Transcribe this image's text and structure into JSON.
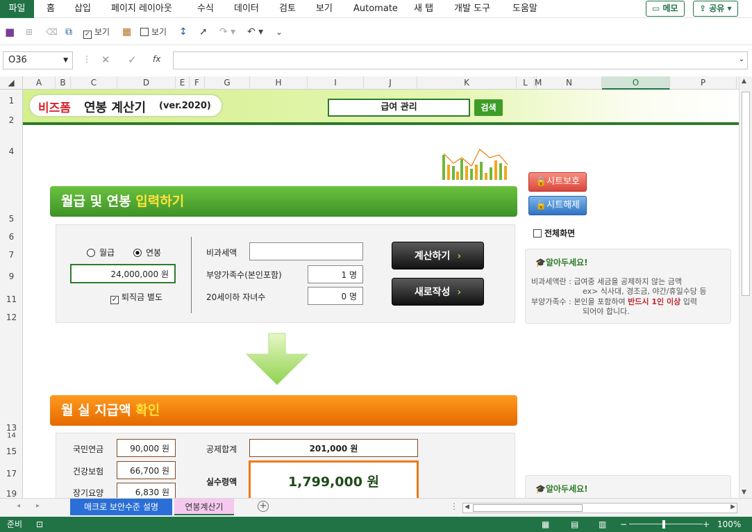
{
  "ribbon": {
    "tabs": [
      "파일",
      "홈",
      "삽입",
      "페이지 레이아웃",
      "수식",
      "데이터",
      "검토",
      "보기",
      "Automate",
      "새 탭",
      "개발 도구",
      "도움말"
    ],
    "memo_label": "메모",
    "share_label": "공유"
  },
  "qat": {
    "view1": "보기",
    "view2": "보기"
  },
  "formula": {
    "name_box": "O36",
    "fx": "fx",
    "content": ""
  },
  "columns": [
    "A",
    "B",
    "C",
    "D",
    "E",
    "F",
    "G",
    "H",
    "I",
    "J",
    "K",
    "L",
    "M",
    "N",
    "O",
    "P"
  ],
  "rows": [
    "1",
    "2",
    "4",
    "5",
    "6",
    "7",
    "9",
    "11",
    "12",
    "13",
    "14",
    "15",
    "17",
    "19"
  ],
  "banner": {
    "brand": "비즈폼",
    "title": "연봉 계산기",
    "version": "(ver.2020)",
    "search_box": "급여 관리",
    "search_button": "검색"
  },
  "side": {
    "protect": "시트보호",
    "unprotect": "시트해제",
    "fullscreen": "전체화면"
  },
  "section1": {
    "title_a": "월급 및 연봉 ",
    "title_b": "입력하기"
  },
  "input": {
    "radio_monthly": "월급",
    "radio_annual": "연봉",
    "amount": "24,000,000 원",
    "severance": "퇴직금 별도",
    "nontax_label": "비과세액",
    "nontax_value": "",
    "dependents_label": "부양가족수(본인포함)",
    "dependents_value": "1 명",
    "children_label": "20세이하 자녀수",
    "children_value": "0 명",
    "calc_button": "계산하기",
    "new_button": "새로작성"
  },
  "notice1": {
    "title": "알아두세요!",
    "l1a": "비과세액란 :",
    "l1b": "급여중 세금을 공제하지 않는 금액",
    "l2": "ex> 식사대, 경조금, 야간/휴일수당 등",
    "l3a": "부양가족수 :",
    "l3b": "본인을 포함하여",
    "l3c": "반드시 1인 이상",
    "l3d": "입력",
    "l4": "되어야 합니다."
  },
  "section2": {
    "title_a": "월 실 지급액 ",
    "title_b": "확인"
  },
  "result": {
    "pension_label": "국민연금",
    "pension": "90,000 원",
    "health_label": "건강보험",
    "health": "66,700 원",
    "care_label": "장기요양",
    "care": "6,830 원",
    "deduct_label": "공제합계",
    "deduct": "201,000 원",
    "net_label": "실수령액",
    "net": "1,799,000 원"
  },
  "notice2": {
    "title": "알아두세요!"
  },
  "sheet_tabs": [
    "매크로 보안수준 설명",
    "연봉계산기"
  ],
  "status": {
    "ready": "준비",
    "zoom": "100%"
  },
  "colors": {
    "excel_green": "#217346",
    "bar_green": "#4da22f",
    "bar_orange": "#f07b0a",
    "accent_yellow": "#ffe23a"
  }
}
